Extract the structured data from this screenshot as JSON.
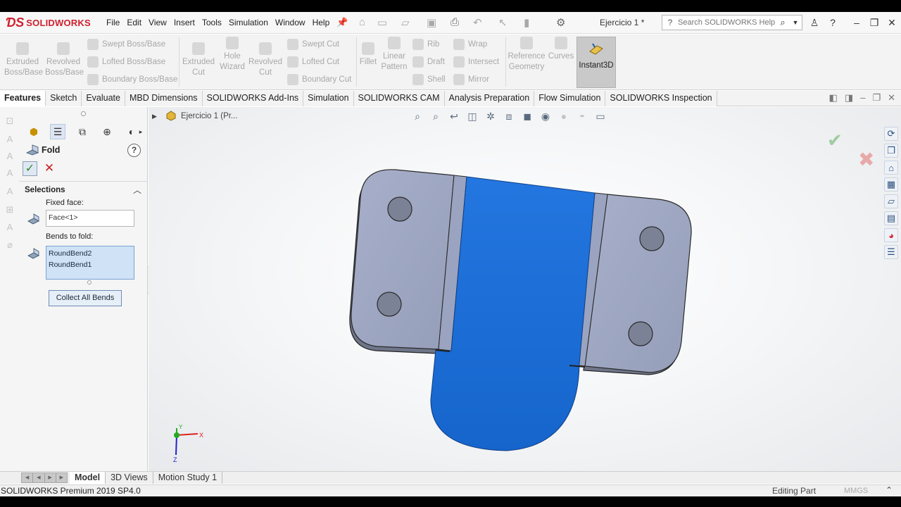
{
  "app": {
    "brand": "SOLIDWORKS",
    "document_title": "Ejercicio 1 *",
    "menus": [
      "File",
      "Edit",
      "View",
      "Insert",
      "Tools",
      "Simulation",
      "Window",
      "Help"
    ],
    "search_placeholder": "Search SOLIDWORKS Help"
  },
  "commands": {
    "extruded_boss": "Extruded Boss/Base",
    "revolved_boss": "Revolved Boss/Base",
    "swept_boss": "Swept Boss/Base",
    "lofted_boss": "Lofted Boss/Base",
    "boundary_boss": "Boundary Boss/Base",
    "extruded_cut": "Extruded Cut",
    "hole_wizard": "Hole Wizard",
    "revolved_cut": "Revolved Cut",
    "swept_cut": "Swept Cut",
    "lofted_cut": "Lofted Cut",
    "boundary_cut": "Boundary Cut",
    "fillet": "Fillet",
    "linear_pattern": "Linear Pattern",
    "rib": "Rib",
    "draft": "Draft",
    "shell": "Shell",
    "wrap": "Wrap",
    "intersect": "Intersect",
    "mirror": "Mirror",
    "reference_geometry": "Reference Geometry",
    "curves": "Curves",
    "instant3d": "Instant3D"
  },
  "tabs": [
    {
      "label": "Features",
      "active": true
    },
    {
      "label": "Sketch",
      "active": false
    },
    {
      "label": "Evaluate",
      "active": false
    },
    {
      "label": "MBD Dimensions",
      "active": false
    },
    {
      "label": "SOLIDWORKS Add-Ins",
      "active": false
    },
    {
      "label": "Simulation",
      "active": false
    },
    {
      "label": "SOLIDWORKS CAM",
      "active": false
    },
    {
      "label": "Analysis Preparation",
      "active": false
    },
    {
      "label": "Flow Simulation",
      "active": false
    },
    {
      "label": "SOLIDWORKS Inspection",
      "active": false
    }
  ],
  "property_manager": {
    "title": "Fold",
    "help": "?",
    "section_title": "Selections",
    "fixed_face_label": "Fixed face:",
    "fixed_face_value": "Face<1>",
    "bends_label": "Bends to fold:",
    "bends": [
      "RoundBend2",
      "RoundBend1"
    ],
    "collect_button": "Collect All Bends"
  },
  "viewport": {
    "tree_label": "Ejercicio 1  (Pr...",
    "triad_x": "X",
    "triad_y": "Y",
    "triad_z": "Z",
    "part_colors": {
      "flange": "#9ea7c4",
      "selected_face": "#1f6fd6",
      "edge": "#2a2a2a"
    }
  },
  "bottom_tabs": [
    {
      "label": "Model",
      "active": true
    },
    {
      "label": "3D Views",
      "active": false
    },
    {
      "label": "Motion Study 1",
      "active": false
    }
  ],
  "status": {
    "version": "SOLIDWORKS Premium 2019 SP4.0",
    "mode": "Editing Part",
    "units": "MMGS"
  }
}
